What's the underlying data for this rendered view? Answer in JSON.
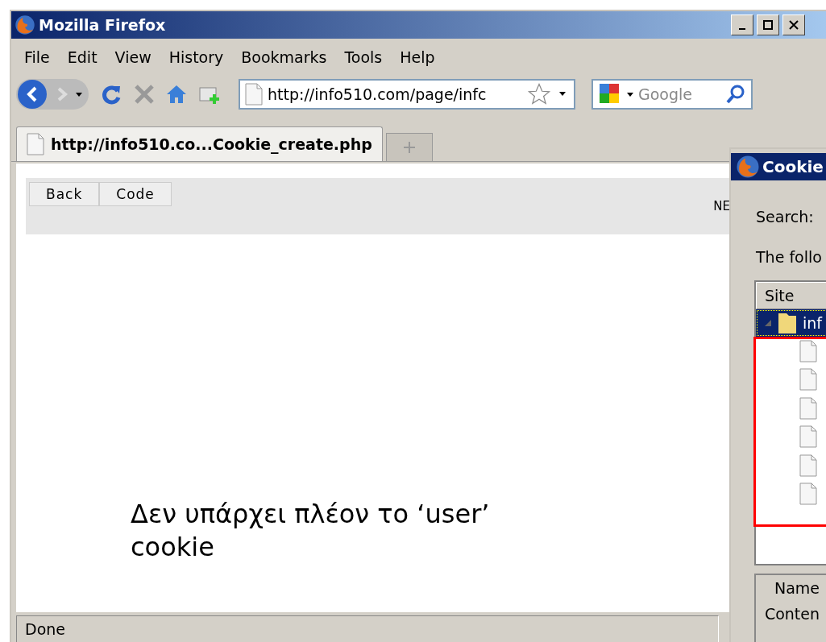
{
  "window": {
    "title": "Mozilla Firefox"
  },
  "menu": [
    "File",
    "Edit",
    "View",
    "History",
    "Bookmarks",
    "Tools",
    "Help"
  ],
  "address_bar": {
    "value": "http://info510.com/page/infc"
  },
  "search_bar": {
    "placeholder": "Google"
  },
  "tabs": [
    {
      "label": "http://info510.co...Cookie_create.php",
      "selected": true
    }
  ],
  "page": {
    "buttons": [
      "Back",
      "Code"
    ],
    "header_text": "NE",
    "annotation": "Δεν υπάρχει πλέον το ‘user’ cookie"
  },
  "status_bar": "Done",
  "cookie_dialog": {
    "title": "Cookie",
    "search_label": "Search:",
    "description": "The follo",
    "columns": [
      "Site"
    ],
    "rows": [
      {
        "label": "inf",
        "selected": true,
        "expanded": true,
        "children": [
          {
            "selected": false
          },
          {
            "selected": false
          },
          {
            "selected": false
          },
          {
            "selected": false
          },
          {
            "selected": false
          },
          {
            "selected": false
          }
        ]
      }
    ],
    "details": [
      "Name",
      "Conten"
    ]
  }
}
